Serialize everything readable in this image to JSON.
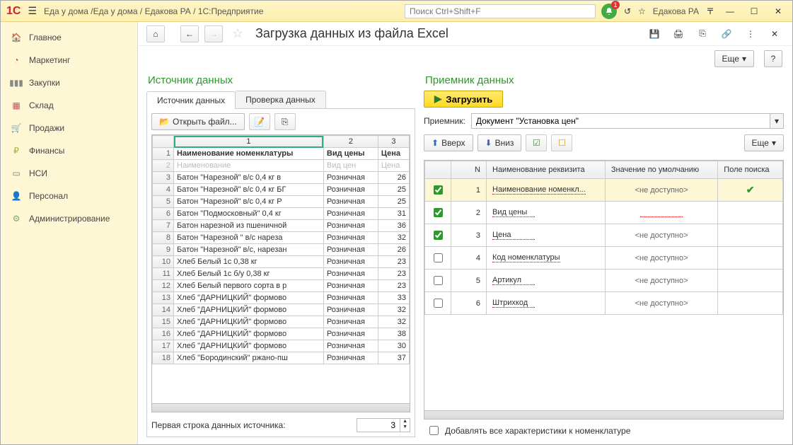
{
  "titlebar": {
    "logo": "1C",
    "title": "Еда у дома /Еда у дома / Едакова РА / 1C:Предприятие",
    "search_placeholder": "Поиск Ctrl+Shift+F",
    "notification_count": "1",
    "user": "Едакова РА"
  },
  "sidebar": {
    "items": [
      {
        "label": "Главное",
        "icon": "home"
      },
      {
        "label": "Маркетинг",
        "icon": "chart"
      },
      {
        "label": "Закупки",
        "icon": "barcode"
      },
      {
        "label": "Склад",
        "icon": "boxes"
      },
      {
        "label": "Продажи",
        "icon": "cart"
      },
      {
        "label": "Финансы",
        "icon": "coin"
      },
      {
        "label": "НСИ",
        "icon": "book"
      },
      {
        "label": "Персонал",
        "icon": "person"
      },
      {
        "label": "Администрирование",
        "icon": "gear"
      }
    ]
  },
  "page": {
    "title": "Загрузка данных из файла Excel",
    "more": "Еще"
  },
  "source": {
    "title": "Источник данных",
    "tabs": [
      "Источник данных",
      "Проверка данных"
    ],
    "open_file": "Открыть файл...",
    "col_nums": [
      "1",
      "2",
      "3"
    ],
    "header_row": {
      "n": "1",
      "c1": "Наименование номенклатуры",
      "c2": "Вид цены",
      "c3": "Цена"
    },
    "disabled_row": {
      "n": "2",
      "c1": "Наименование",
      "c2": "Вид цен",
      "c3": "Цена"
    },
    "rows": [
      {
        "n": "3",
        "c1": "Батон \"Нарезной\" в/с 0,4 кг в",
        "c2": "Розничная",
        "c3": "26"
      },
      {
        "n": "4",
        "c1": "Батон \"Нарезной\" в/с 0,4 кг БГ",
        "c2": "Розничная",
        "c3": "25"
      },
      {
        "n": "5",
        "c1": "Батон \"Нарезной\" в/с 0,4 кг Р",
        "c2": "Розничная",
        "c3": "25"
      },
      {
        "n": "6",
        "c1": "Батон \"Подмосковный\" 0,4 кг",
        "c2": "Розничная",
        "c3": "31"
      },
      {
        "n": "7",
        "c1": "Батон нарезной из пшеничной",
        "c2": "Розничная",
        "c3": "36"
      },
      {
        "n": "8",
        "c1": "Батон \"Нарезной \"  в/с нареза",
        "c2": "Розничная",
        "c3": "32"
      },
      {
        "n": "9",
        "c1": "Батон \"Нарезной\" в/с, нарезан",
        "c2": "Розничная",
        "c3": "26"
      },
      {
        "n": "10",
        "c1": "Хлеб Белый 1с 0,38 кг",
        "c2": "Розничная",
        "c3": "23"
      },
      {
        "n": "11",
        "c1": "Хлеб Белый 1с б/у 0,38 кг",
        "c2": "Розничная",
        "c3": "23"
      },
      {
        "n": "12",
        "c1": "Хлеб Белый  первого сорта в р",
        "c2": "Розничная",
        "c3": "23"
      },
      {
        "n": "13",
        "c1": "Хлеб \"ДАРНИЦКИЙ\" формово",
        "c2": "Розничная",
        "c3": "33"
      },
      {
        "n": "14",
        "c1": "Хлеб \"ДАРНИЦКИЙ\" формово",
        "c2": "Розничная",
        "c3": "32"
      },
      {
        "n": "15",
        "c1": "Хлеб \"ДАРНИЦКИЙ\" формово",
        "c2": "Розничная",
        "c3": "32"
      },
      {
        "n": "16",
        "c1": "Хлеб \"ДАРНИЦКИЙ\" формово",
        "c2": "Розничная",
        "c3": "38"
      },
      {
        "n": "17",
        "c1": "Хлеб \"ДАРНИЦКИЙ\" формово",
        "c2": "Розничная",
        "c3": "30"
      },
      {
        "n": "18",
        "c1": "Хлеб \"Бородинский\" ржано-пш",
        "c2": "Розничная",
        "c3": "37"
      }
    ],
    "first_row_label": "Первая строка данных источника:",
    "first_row_value": "3"
  },
  "dest": {
    "title": "Приемник данных",
    "load_btn": "Загрузить",
    "receiver_label": "Приемник:",
    "receiver_value": "Документ \"Установка цен\"",
    "up": "Вверх",
    "down": "Вниз",
    "more": "Еще",
    "headers": {
      "n": "N",
      "name": "Наименование реквизита",
      "default": "Значение по умолчанию",
      "search": "Поле поиска"
    },
    "rows": [
      {
        "chk": true,
        "n": "1",
        "name": "Наименование номенкл...",
        "def": "<не доступно>",
        "ok": true,
        "hl": true
      },
      {
        "chk": true,
        "n": "2",
        "name": "Вид цены",
        "def": "",
        "ok": false,
        "hl": false
      },
      {
        "chk": true,
        "n": "3",
        "name": "Цена",
        "def": "<не доступно>",
        "ok": false,
        "hl": false
      },
      {
        "chk": false,
        "n": "4",
        "name": "Код номенклатуры",
        "def": "<не доступно>",
        "ok": false,
        "hl": false
      },
      {
        "chk": false,
        "n": "5",
        "name": "Артикул",
        "def": "<не доступно>",
        "ok": false,
        "hl": false
      },
      {
        "chk": false,
        "n": "6",
        "name": "Штрихкод",
        "def": "<не доступно>",
        "ok": false,
        "hl": false
      }
    ],
    "add_all_label": "Добавлять все характеристики к номенклатуре"
  }
}
